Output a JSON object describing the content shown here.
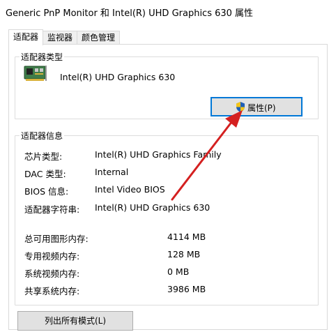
{
  "window": {
    "title": "Generic PnP Monitor 和 Intel(R) UHD Graphics 630 属性"
  },
  "tabs": [
    {
      "label": "适配器"
    },
    {
      "label": "监视器"
    },
    {
      "label": "颜色管理"
    }
  ],
  "adapter_type": {
    "group_title": "适配器类型",
    "name": "Intel(R) UHD Graphics 630",
    "properties_button": "属性(P)"
  },
  "adapter_info": {
    "group_title": "适配器信息",
    "rows": [
      {
        "label": "芯片类型:",
        "value": "Intel(R) UHD Graphics Family"
      },
      {
        "label": "DAC 类型:",
        "value": "Internal"
      },
      {
        "label": "BIOS 信息:",
        "value": "Intel Video BIOS"
      },
      {
        "label": "适配器字符串:",
        "value": "Intel(R) UHD Graphics 630"
      }
    ],
    "memory": [
      {
        "label": "总可用图形内存:",
        "value": "4114 MB"
      },
      {
        "label": "专用视频内存:",
        "value": "128 MB"
      },
      {
        "label": "系统视频内存:",
        "value": "0 MB"
      },
      {
        "label": "共享系统内存:",
        "value": "3986 MB"
      }
    ]
  },
  "list_modes_button": "列出所有模式(L)",
  "colors": {
    "accent": "#0078d7",
    "arrow": "#d42020"
  }
}
